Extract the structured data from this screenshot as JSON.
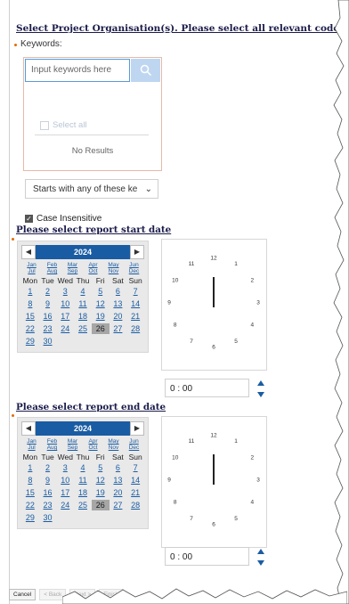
{
  "header": {
    "title": "Select Project Organisation(s). Please select all relevant codes"
  },
  "keywords": {
    "label": "Keywords:",
    "placeholder": "Input keywords here",
    "select_all": "Select all",
    "no_results": "No Results",
    "match_mode": "Starts with any of these ke",
    "case_insensitive": "Case Insensitive",
    "case_insensitive_checked": true
  },
  "start_date": {
    "title": "Please select report start date",
    "year": "2024",
    "months_row1": [
      "Jan",
      "Feb",
      "Mar",
      "Apr",
      "May",
      "Jun"
    ],
    "months_row2": [
      "Jul",
      "Aug",
      "Sep",
      "Oct",
      "Nov",
      "Dec"
    ],
    "dow": [
      "Mon",
      "Tue",
      "Wed",
      "Thu",
      "Fri",
      "Sat",
      "Sun"
    ],
    "days": [
      "1",
      "2",
      "3",
      "4",
      "5",
      "6",
      "7",
      "8",
      "9",
      "10",
      "11",
      "12",
      "13",
      "14",
      "15",
      "16",
      "17",
      "18",
      "19",
      "20",
      "21",
      "22",
      "23",
      "24",
      "25",
      "26",
      "27",
      "28",
      "29",
      "30"
    ],
    "selected_day": "26",
    "time": "0 : 00",
    "clock_numbers": [
      "12",
      "1",
      "2",
      "3",
      "4",
      "5",
      "6",
      "7",
      "8",
      "9",
      "10",
      "11"
    ]
  },
  "end_date": {
    "title": "Please select report end date",
    "year": "2024",
    "months_row1": [
      "Jan",
      "Feb",
      "Mar",
      "Apr",
      "May",
      "Jun"
    ],
    "months_row2": [
      "Jul",
      "Aug",
      "Sep",
      "Oct",
      "Nov",
      "Dec"
    ],
    "dow": [
      "Mon",
      "Tue",
      "Wed",
      "Thu",
      "Fri",
      "Sat",
      "Sun"
    ],
    "days": [
      "1",
      "2",
      "3",
      "4",
      "5",
      "6",
      "7",
      "8",
      "9",
      "10",
      "11",
      "12",
      "13",
      "14",
      "15",
      "16",
      "17",
      "18",
      "19",
      "20",
      "21",
      "22",
      "23",
      "24",
      "25",
      "26",
      "27",
      "28",
      "29",
      "30"
    ],
    "selected_day": "26",
    "time": "0 : 00",
    "clock_numbers": [
      "12",
      "1",
      "2",
      "3",
      "4",
      "5",
      "6",
      "7",
      "8",
      "9",
      "10",
      "11"
    ]
  },
  "wizard": {
    "cancel": "Cancel",
    "back": "< Back",
    "next": "Next >",
    "finish": "Finish"
  },
  "colors": {
    "accent": "#1a5ca3",
    "required": "#e36b00",
    "today_bg": "#a6a6a6"
  }
}
